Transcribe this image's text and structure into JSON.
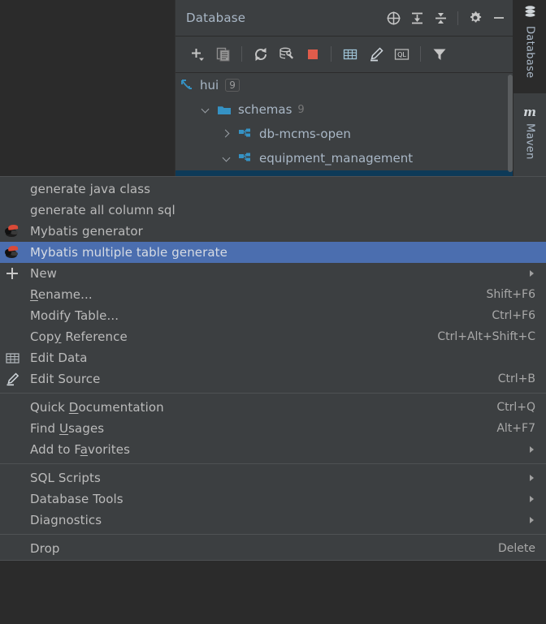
{
  "panel": {
    "title": "Database",
    "header_icons": [
      {
        "name": "scroll-from-source-icon"
      },
      {
        "name": "expand-all-icon"
      },
      {
        "name": "collapse-all-icon"
      },
      {
        "name": "settings-gear-icon"
      },
      {
        "name": "hide-minimize-icon"
      }
    ],
    "toolbar_icons": [
      {
        "name": "add-new-icon"
      },
      {
        "name": "duplicate-icon"
      },
      {
        "name": "refresh-icon"
      },
      {
        "name": "database-tools-icon"
      },
      {
        "name": "stop-icon"
      },
      {
        "name": "edit-data-table-icon"
      },
      {
        "name": "edit-source-pencil-icon"
      },
      {
        "name": "ql-console-icon"
      },
      {
        "name": "filter-icon"
      }
    ]
  },
  "tree": {
    "rows": [
      {
        "label": "hui",
        "badge": "9",
        "indent": 0,
        "twisty": "",
        "icon": "connection-icon"
      },
      {
        "label": "schemas",
        "count": "9",
        "indent": 1,
        "twisty": "down",
        "icon": "folder-icon"
      },
      {
        "label": "db-mcms-open",
        "count": "",
        "indent": 2,
        "twisty": "right",
        "icon": "schema-icon"
      },
      {
        "label": "equipment_management",
        "count": "",
        "indent": 2,
        "twisty": "down",
        "icon": "schema-icon"
      }
    ]
  },
  "right_strip": {
    "buttons": [
      {
        "label": "Database",
        "icon": "database-stack-icon",
        "active": true
      },
      {
        "label": "Maven",
        "icon": "maven-m-icon",
        "active": false
      }
    ]
  },
  "context_menu": {
    "items": [
      {
        "type": "item",
        "name": "generate-java-class",
        "label": "generate java class",
        "icon": "",
        "shortcut": "",
        "submenu": false,
        "highlight": false
      },
      {
        "type": "item",
        "name": "generate-all-column-sql",
        "label": "generate all column sql",
        "icon": "",
        "shortcut": "",
        "submenu": false,
        "highlight": false
      },
      {
        "type": "item",
        "name": "mybatis-generator",
        "label": "Mybatis generator",
        "icon": "mybatis-bird-icon",
        "shortcut": "",
        "submenu": false,
        "highlight": false
      },
      {
        "type": "item",
        "name": "mybatis-multiple-table-generate",
        "label": "Mybatis multiple table generate",
        "icon": "mybatis-bird-icon",
        "shortcut": "",
        "submenu": false,
        "highlight": true
      },
      {
        "type": "item",
        "name": "new",
        "label": "New",
        "icon": "plus-icon",
        "shortcut": "",
        "submenu": true,
        "highlight": false
      },
      {
        "type": "item",
        "name": "rename",
        "label": "Rename...",
        "mnemonic": "R",
        "icon": "",
        "shortcut": "Shift+F6",
        "submenu": false,
        "highlight": false
      },
      {
        "type": "item",
        "name": "modify-table",
        "label": "Modify Table...",
        "icon": "",
        "shortcut": "Ctrl+F6",
        "submenu": false,
        "highlight": false
      },
      {
        "type": "item",
        "name": "copy-reference",
        "label": "Copy Reference",
        "mnemonic": "y",
        "icon": "",
        "shortcut": "Ctrl+Alt+Shift+C",
        "submenu": false,
        "highlight": false
      },
      {
        "type": "item",
        "name": "edit-data",
        "label": "Edit Data",
        "icon": "table-grid-icon",
        "shortcut": "",
        "submenu": false,
        "highlight": false
      },
      {
        "type": "item",
        "name": "edit-source",
        "label": "Edit Source",
        "icon": "pencil-icon",
        "shortcut": "Ctrl+B",
        "submenu": false,
        "highlight": false
      },
      {
        "type": "separator"
      },
      {
        "type": "item",
        "name": "quick-documentation",
        "label": "Quick Documentation",
        "mnemonic": "D",
        "icon": "",
        "shortcut": "Ctrl+Q",
        "submenu": false,
        "highlight": false
      },
      {
        "type": "item",
        "name": "find-usages",
        "label": "Find Usages",
        "mnemonic": "U",
        "icon": "",
        "shortcut": "Alt+F7",
        "submenu": false,
        "highlight": false
      },
      {
        "type": "item",
        "name": "add-to-favorites",
        "label": "Add to Favorites",
        "mnemonic": "a",
        "icon": "",
        "shortcut": "",
        "submenu": true,
        "highlight": false
      },
      {
        "type": "separator"
      },
      {
        "type": "item",
        "name": "sql-scripts",
        "label": "SQL Scripts",
        "icon": "",
        "shortcut": "",
        "submenu": true,
        "highlight": false
      },
      {
        "type": "item",
        "name": "database-tools",
        "label": "Database Tools",
        "icon": "",
        "shortcut": "",
        "submenu": true,
        "highlight": false
      },
      {
        "type": "item",
        "name": "diagnostics",
        "label": "Diagnostics",
        "icon": "",
        "shortcut": "",
        "submenu": true,
        "highlight": false
      },
      {
        "type": "separator"
      },
      {
        "type": "item",
        "name": "drop",
        "label": "Drop",
        "icon": "",
        "shortcut": "Delete",
        "submenu": false,
        "highlight": false
      }
    ]
  },
  "colors": {
    "panel_bg": "#3c3f41",
    "editor_bg": "#2b2b2b",
    "menu_bg": "#3c3f41",
    "highlight": "#4b6eaf",
    "tree_selection": "#0d3a58",
    "accent_cyan": "#3592c4",
    "text": "#bbbbbb",
    "stop_red": "#e05c4b"
  }
}
